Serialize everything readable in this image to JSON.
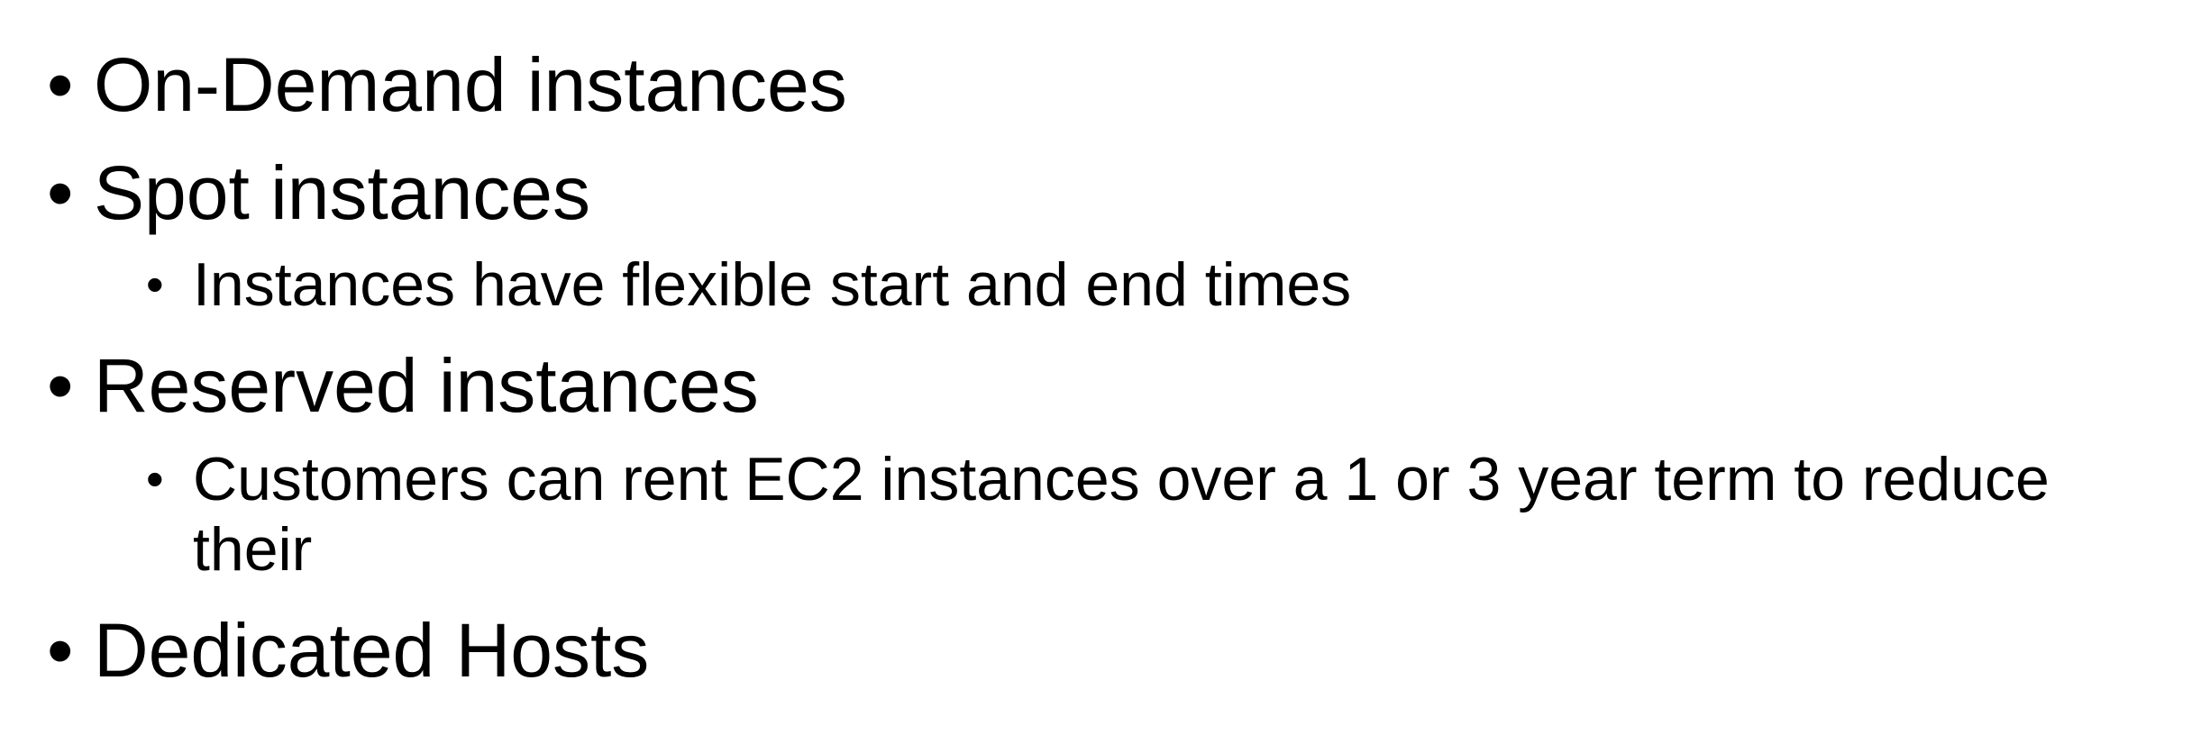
{
  "bullet_glyph": "•",
  "items": [
    {
      "text": "On-Demand instances"
    },
    {
      "text": "Spot instances"
    },
    {
      "text": "Instances have flexible start and end times"
    },
    {
      "text": "Reserved instances"
    },
    {
      "text": "Customers can rent EC2 instances over a 1 or 3 year term to reduce"
    },
    {
      "text": "their"
    },
    {
      "text": "Dedicated Hosts"
    }
  ]
}
